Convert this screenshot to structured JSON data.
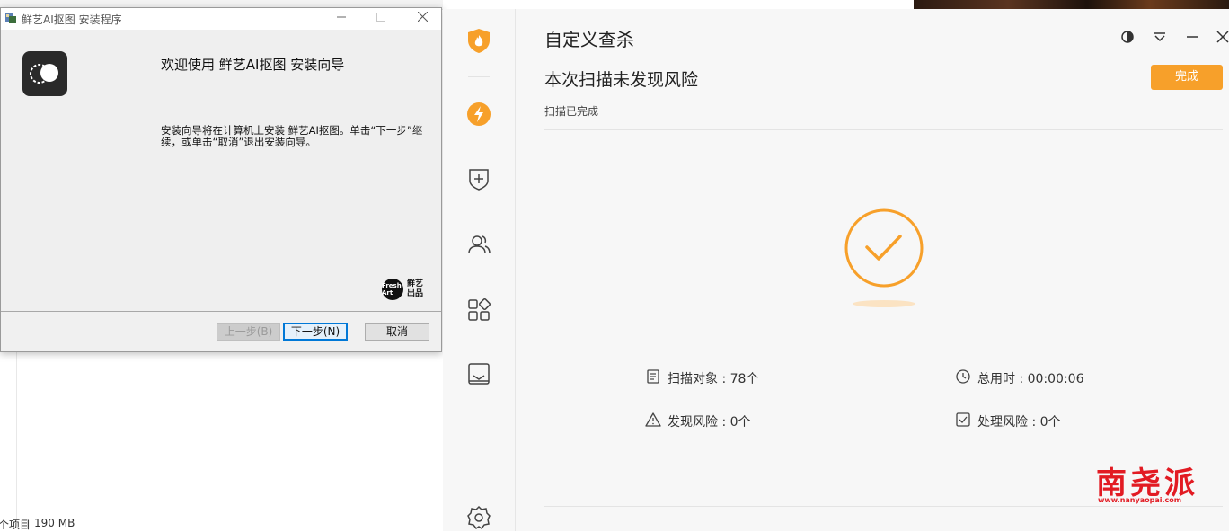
{
  "explorer": {
    "status_items": "个项目",
    "status_size": "190 MB"
  },
  "installer": {
    "title": "鲜艺AI抠图 安装程序",
    "heading": "欢迎使用 鲜艺AI抠图 安装向导",
    "description": "安装向导将在计算机上安装 鲜艺AI抠图。单击“下一步”继续，或单击“取消”退出安装向导。",
    "brand_circle": "Fresh Art",
    "brand_text_line1": "鲜艺",
    "brand_text_line2": "出品",
    "buttons": {
      "back": "上一步(B)",
      "next": "下一步(N)",
      "cancel": "取消"
    }
  },
  "security": {
    "title": "自定义查杀",
    "headline": "本次扫描未发现风险",
    "subtext": "扫描已完成",
    "done_button": "完成",
    "accent_color": "#f7a02a",
    "stats": {
      "scan_objects": "扫描对象 : 78个",
      "total_time": "总用时 : 00:00:06",
      "risks_found": "发现风险 : 0个",
      "risks_handled": "处理风险 : 0个"
    },
    "sidebar_icons": [
      "shield-flame-icon",
      "bolt-icon",
      "shield-plus-icon",
      "users-icon",
      "apps-icon",
      "inbox-icon",
      "settings-icon"
    ]
  },
  "watermark": {
    "text": "南尧派",
    "url": "www.nanyaopai.com"
  }
}
